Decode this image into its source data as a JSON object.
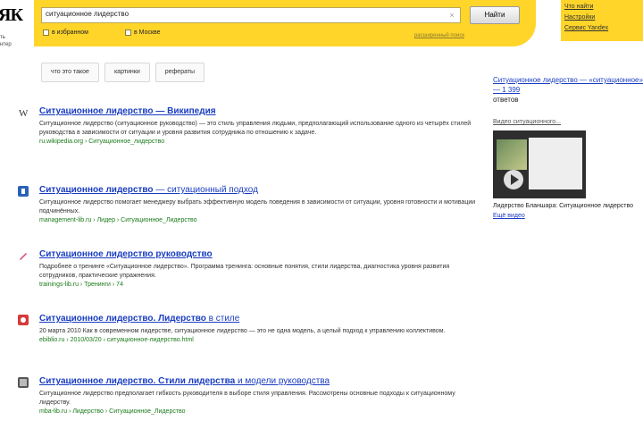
{
  "logo": {
    "mark": "ЯК",
    "sub": "ть\nнтер"
  },
  "search": {
    "query": "ситуационное лидерство",
    "button_label": "Найти",
    "option_1": "в избранном",
    "option_2": "в Москве",
    "advanced_link": "расширенный поиск"
  },
  "corner_links": [
    "Что найти",
    "Настройки",
    "Сервис Yandex"
  ],
  "tabs": [
    "что это такое",
    "картинки",
    "рефераты"
  ],
  "results": [
    {
      "title": "Ситуационное лидерство — Википедия",
      "title_rest": "",
      "snippet": "Ситуационное лидерство (ситуационное руководство) — это стиль управления людьми, предполагающий использование одного из четырёх стилей руководства в зависимости от ситуации и уровня развития сотрудника по отношению к задаче.",
      "url": "ru.wikipedia.org › Ситуационное_лидерство"
    },
    {
      "title": "Ситуационное лидерство",
      "title_rest": " — ситуационный подход",
      "snippet": "Ситуационное лидерство помогает менеджеру выбрать эффективную модель поведения в зависимости от ситуации, уровня готовности и мотивации подчинённых.",
      "url": "management-lib.ru › Лидер › Ситуационное_Лидерство"
    },
    {
      "title": "Ситуационное лидерство руководство",
      "title_rest": "",
      "snippet": "Подробнее о тренинге «Ситуационное лидерство». Программа тренинга: основные понятия, стили лидерства, диагностика уровня развития сотрудников, практические упражнения.",
      "url": "trainings-lib.ru › Тренинги › 74"
    },
    {
      "title": "Ситуационное лидерство. Лидерство",
      "title_rest": " в стиле",
      "snippet": "20 марта 2010 Как в современном лидерстве, ситуационное лидерство — это не одна модель, а целый подход к управлению коллективом.",
      "url": "ebiblio.ru › 2010/03/20 › ситуационное-лидерство.html"
    },
    {
      "title": "Ситуационное лидерство. Стили лидерства",
      "title_rest": " и модели руководства",
      "snippet": "Ситуационное лидерство предполагает гибкость руководителя в выборе стиля управления. Рассмотрены основные подходы к ситуационному лидерству.",
      "url": "mba-lib.ru › Лидерство › Ситуационное_Лидерство"
    }
  ],
  "side": {
    "link": "Ситуационное лидерство — «ситуационное» — 1 399",
    "text": "ответов",
    "video_heading": "Видео ситуационного...",
    "video_caption": "Лидерство Бланшара: Ситуационное лидерство",
    "more_link": "Ещё видео"
  },
  "colors": {
    "brand_yellow": "#ffd52a",
    "link_blue": "#1a3dc1",
    "url_green": "#1a7a1a"
  }
}
